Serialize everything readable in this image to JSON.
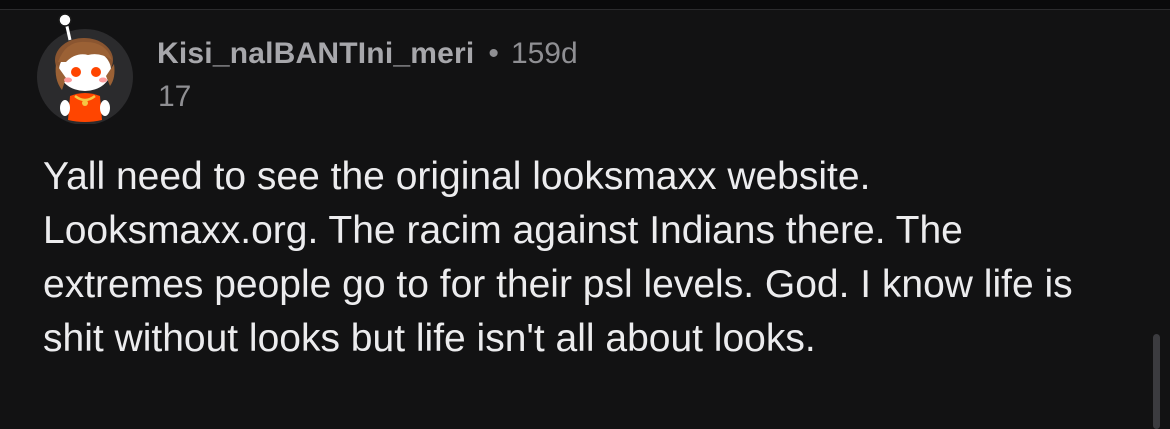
{
  "comment": {
    "username": "Kisi_nalBANTIni_meri",
    "separator": "•",
    "age": "159d",
    "score": "17",
    "body": "Yall need to see the original looksmaxx website. Looksmaxx.org. The racim against Indians there. The extremes people go to for their psl levels. God. I know life is shit without looks but life isn't all about looks.",
    "avatar_icon": "reddit-snoo-avatar-icon"
  },
  "colors": {
    "background": "#121213",
    "username": "#a7a7ab",
    "meta": "#8f8f93",
    "body_text": "#ececee",
    "avatar_bg": "#2a2a2c",
    "avatar_shirt": "#ff4500"
  }
}
